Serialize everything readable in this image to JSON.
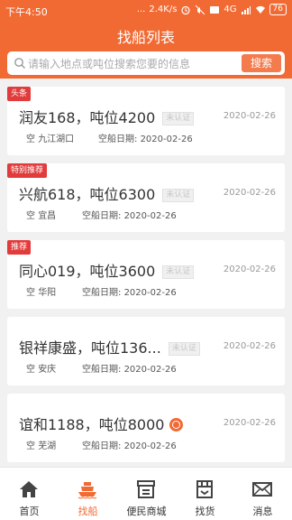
{
  "status_bar": {
    "time": "下午4:50",
    "net_speed": "2.4K/s",
    "signal": "4G",
    "battery": "76"
  },
  "header": {
    "title": "找船列表"
  },
  "search": {
    "placeholder": "请输入地点或吨位搜索您要的信息",
    "button_label": "搜索"
  },
  "ships": [
    {
      "tag": "头条",
      "name": "润友168，吨位4200",
      "cert_label": "未认证",
      "date": "2020-02-26",
      "status": "空",
      "location": "九江湖口",
      "ship_date_label": "空船日期:",
      "ship_date": "2020-02-26"
    },
    {
      "tag": "特别推荐",
      "name": "兴航618，吨位6300",
      "cert_label": "未认证",
      "date": "2020-02-26",
      "status": "空",
      "location": "宜昌",
      "ship_date_label": "空船日期:",
      "ship_date": "2020-02-26"
    },
    {
      "tag": "推荐",
      "name": "同心019，吨位3600",
      "cert_label": "未认证",
      "date": "2020-02-26",
      "status": "空",
      "location": "华阳",
      "ship_date_label": "空船日期:",
      "ship_date": "2020-02-26"
    },
    {
      "tag": "",
      "name": "银祥康盛，吨位136...",
      "cert_label": "未认证",
      "date": "2020-02-26",
      "status": "空",
      "location": "安庆",
      "ship_date_label": "空船日期:",
      "ship_date": "2020-02-26"
    },
    {
      "tag": "",
      "name": "谊和1188，吨位8000",
      "cert_label": "",
      "date": "2020-02-26",
      "status": "空",
      "location": "芜湖",
      "ship_date_label": "空船日期:",
      "ship_date": "2020-02-26"
    }
  ],
  "tabs": [
    {
      "label": "首页",
      "icon": "home-icon"
    },
    {
      "label": "找船",
      "icon": "ship-icon"
    },
    {
      "label": "便民商城",
      "icon": "store-icon"
    },
    {
      "label": "找货",
      "icon": "cargo-icon"
    },
    {
      "label": "消息",
      "icon": "mail-icon"
    }
  ],
  "colors": {
    "brand": "#f26a33",
    "tag_red": "#e13b3b"
  }
}
